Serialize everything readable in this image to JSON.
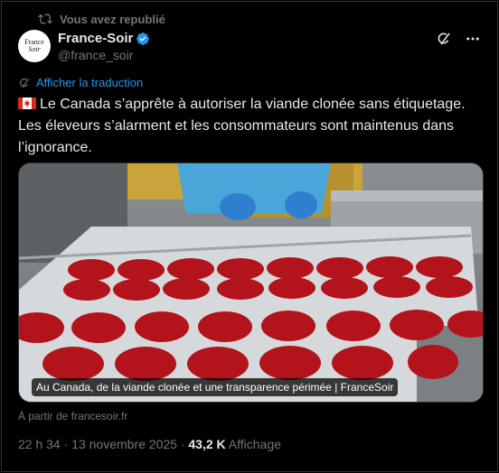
{
  "repost_label": "Vous avez republié",
  "author": {
    "avatar_line1": "France",
    "avatar_line2": "Soir",
    "display_name": "France-Soir",
    "handle": "@france_soir"
  },
  "translate_label": "Afficher la traduction",
  "tweet_text": "Le Canada s’apprête à autoriser la viande clonée sans étiquetage. Les éleveurs s’alarment et les consommateurs sont maintenus dans l’ignorance.",
  "media": {
    "caption": "Au Canada, de la viande clonée et une transparence périmée | FranceSoir"
  },
  "source_link": "À partir de francesoir.fr",
  "meta": {
    "time": "22 h 34",
    "separator": "·",
    "date": "13 novembre 2025",
    "views_count": "43,2 K",
    "views_label": "Affichage"
  },
  "colors": {
    "background": "#000000",
    "text_primary": "#e7e9ea",
    "text_secondary": "#71767b",
    "accent": "#1d9bf0",
    "border": "#2f3336"
  },
  "icons": [
    "repost-icon",
    "verified-badge-icon",
    "grok-icon",
    "more-icon",
    "translate-icon",
    "canada-flag-icon"
  ]
}
